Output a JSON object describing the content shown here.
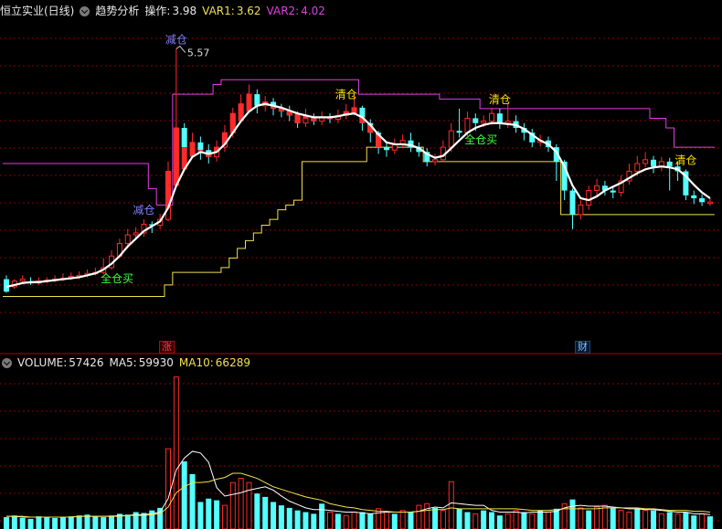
{
  "header": {
    "title": "恒立实业(日线)",
    "indicator_name": "趋势分析",
    "op_label": "操作:",
    "op_value": "3.98",
    "var1_label": "VAR1:",
    "var1_value": "3.62",
    "var2_label": "VAR2:",
    "var2_value": "4.02"
  },
  "volume_header": {
    "label": "VOLUME:",
    "value": "57426",
    "ma5_label": "MA5:",
    "ma5_value": "59930",
    "ma10_label": "MA10:",
    "ma10_value": "66289"
  },
  "markers": {
    "zhang": "涨",
    "cai": "财"
  },
  "colors": {
    "bg": "#000000",
    "up": "#ff2a2a",
    "down": "#54ffff",
    "ma": "#ffffff",
    "var1": "#f0e050",
    "var2": "#e040e0",
    "grid": "#8b0000",
    "label_yellow": "#ffe000",
    "label_green": "#40ff40",
    "label_blue": "#8080ff"
  },
  "chart_data": {
    "type": "candlestick",
    "peak_label": "5.57",
    "candles": [
      [
        3.18,
        3.05,
        3.22,
        3.04
      ],
      [
        3.1,
        3.16,
        3.18,
        3.08
      ],
      [
        3.16,
        3.18,
        3.22,
        3.14
      ],
      [
        3.15,
        3.14,
        3.2,
        3.12
      ],
      [
        3.14,
        3.16,
        3.2,
        3.12
      ],
      [
        3.16,
        3.17,
        3.2,
        3.14
      ],
      [
        3.17,
        3.18,
        3.22,
        3.15
      ],
      [
        3.18,
        3.19,
        3.24,
        3.16
      ],
      [
        3.19,
        3.21,
        3.25,
        3.17
      ],
      [
        3.21,
        3.22,
        3.26,
        3.18
      ],
      [
        3.22,
        3.24,
        3.28,
        3.2
      ],
      [
        3.24,
        3.25,
        3.3,
        3.22
      ],
      [
        3.25,
        3.3,
        3.4,
        3.23
      ],
      [
        3.3,
        3.42,
        3.48,
        3.28
      ],
      [
        3.42,
        3.55,
        3.6,
        3.4
      ],
      [
        3.55,
        3.64,
        3.7,
        3.5
      ],
      [
        3.64,
        3.66,
        3.72,
        3.6
      ],
      [
        3.66,
        3.75,
        3.8,
        3.62
      ],
      [
        3.75,
        3.74,
        3.78,
        3.66
      ],
      [
        3.74,
        3.8,
        3.86,
        3.7
      ],
      [
        3.8,
        4.3,
        4.4,
        3.78
      ],
      [
        4.3,
        4.75,
        5.57,
        4.2
      ],
      [
        4.75,
        4.55,
        4.8,
        4.4
      ],
      [
        4.55,
        4.6,
        4.7,
        4.45
      ],
      [
        4.6,
        4.52,
        4.66,
        4.42
      ],
      [
        4.52,
        4.45,
        4.58,
        4.38
      ],
      [
        4.45,
        4.55,
        4.62,
        4.4
      ],
      [
        4.55,
        4.7,
        4.78,
        4.5
      ],
      [
        4.7,
        4.9,
        4.96,
        4.65
      ],
      [
        4.9,
        5.0,
        5.1,
        4.85
      ],
      [
        5.0,
        5.1,
        5.2,
        4.92
      ],
      [
        5.1,
        4.98,
        5.15,
        4.9
      ],
      [
        4.98,
        5.02,
        5.08,
        4.92
      ],
      [
        5.02,
        4.95,
        5.06,
        4.88
      ],
      [
        4.95,
        4.92,
        5.0,
        4.86
      ],
      [
        4.92,
        4.88,
        4.98,
        4.82
      ],
      [
        4.88,
        4.8,
        4.92,
        4.75
      ],
      [
        4.8,
        4.85,
        4.95,
        4.76
      ],
      [
        4.85,
        4.82,
        4.9,
        4.78
      ],
      [
        4.82,
        4.86,
        4.92,
        4.78
      ],
      [
        4.86,
        4.84,
        4.9,
        4.8
      ],
      [
        4.84,
        4.88,
        4.94,
        4.8
      ],
      [
        4.88,
        4.92,
        5.0,
        4.84
      ],
      [
        4.92,
        4.96,
        5.1,
        4.88
      ],
      [
        4.96,
        4.8,
        4.98,
        4.72
      ],
      [
        4.8,
        4.7,
        4.84,
        4.6
      ],
      [
        4.7,
        4.55,
        4.72,
        4.48
      ],
      [
        4.55,
        4.52,
        4.6,
        4.45
      ],
      [
        4.52,
        4.58,
        4.64,
        4.48
      ],
      [
        4.58,
        4.62,
        4.68,
        4.54
      ],
      [
        4.62,
        4.55,
        4.7,
        4.5
      ],
      [
        4.55,
        4.5,
        4.6,
        4.45
      ],
      [
        4.5,
        4.4,
        4.54,
        4.35
      ],
      [
        4.4,
        4.42,
        4.48,
        4.36
      ],
      [
        4.42,
        4.55,
        4.62,
        4.4
      ],
      [
        4.55,
        4.72,
        4.8,
        4.5
      ],
      [
        4.72,
        4.7,
        4.95,
        4.65
      ],
      [
        4.7,
        4.85,
        4.92,
        4.66
      ],
      [
        4.85,
        4.8,
        4.9,
        4.72
      ],
      [
        4.8,
        4.82,
        4.88,
        4.76
      ],
      [
        4.82,
        4.9,
        4.96,
        4.78
      ],
      [
        4.9,
        4.8,
        4.95,
        4.74
      ],
      [
        4.8,
        4.82,
        5.0,
        4.75
      ],
      [
        4.82,
        4.75,
        4.88,
        4.7
      ],
      [
        4.75,
        4.7,
        4.8,
        4.62
      ],
      [
        4.7,
        4.6,
        4.74,
        4.55
      ],
      [
        4.6,
        4.62,
        4.68,
        4.56
      ],
      [
        4.62,
        4.55,
        4.66,
        4.5
      ],
      [
        4.55,
        4.4,
        4.58,
        4.2
      ],
      [
        4.4,
        4.1,
        4.42,
        4.0
      ],
      [
        4.1,
        3.85,
        4.12,
        3.7
      ],
      [
        3.85,
        3.95,
        4.0,
        3.8
      ],
      [
        3.95,
        4.1,
        4.15,
        3.9
      ],
      [
        4.1,
        4.15,
        4.22,
        4.05
      ],
      [
        4.15,
        4.1,
        4.2,
        4.05
      ],
      [
        4.1,
        4.08,
        4.15,
        4.02
      ],
      [
        4.08,
        4.2,
        4.26,
        4.04
      ],
      [
        4.2,
        4.3,
        4.38,
        4.16
      ],
      [
        4.3,
        4.38,
        4.46,
        4.25
      ],
      [
        4.38,
        4.42,
        4.5,
        4.34
      ],
      [
        4.42,
        4.35,
        4.46,
        4.28
      ],
      [
        4.35,
        4.4,
        4.45,
        4.3
      ],
      [
        4.4,
        4.35,
        4.44,
        4.1
      ],
      [
        4.35,
        4.3,
        4.4,
        4.2
      ],
      [
        4.3,
        4.05,
        4.32,
        4.0
      ],
      [
        4.05,
        4.02,
        4.1,
        3.96
      ],
      [
        4.02,
        3.98,
        4.06,
        3.94
      ],
      [
        3.98,
        3.98,
        4.02,
        3.94
      ]
    ],
    "ma": [
      3.1,
      3.12,
      3.14,
      3.15,
      3.15,
      3.16,
      3.17,
      3.18,
      3.19,
      3.2,
      3.22,
      3.24,
      3.28,
      3.34,
      3.42,
      3.52,
      3.6,
      3.68,
      3.73,
      3.78,
      3.92,
      4.15,
      4.32,
      4.45,
      4.5,
      4.48,
      4.5,
      4.58,
      4.7,
      4.82,
      4.92,
      4.98,
      5.0,
      4.98,
      4.96,
      4.93,
      4.9,
      4.88,
      4.86,
      4.86,
      4.86,
      4.87,
      4.89,
      4.9,
      4.86,
      4.78,
      4.68,
      4.6,
      4.58,
      4.58,
      4.57,
      4.54,
      4.48,
      4.44,
      4.46,
      4.54,
      4.62,
      4.7,
      4.75,
      4.78,
      4.8,
      4.8,
      4.79,
      4.78,
      4.74,
      4.68,
      4.62,
      4.58,
      4.5,
      4.35,
      4.15,
      4.02,
      4.0,
      4.04,
      4.1,
      4.14,
      4.18,
      4.23,
      4.28,
      4.32,
      4.34,
      4.35,
      4.34,
      4.32,
      4.25,
      4.16,
      4.08,
      4.02
    ],
    "var1": [
      3.0,
      3.0,
      3.0,
      3.0,
      3.0,
      3.0,
      3.0,
      3.0,
      3.0,
      3.0,
      3.0,
      3.0,
      3.0,
      3.0,
      3.0,
      3.0,
      3.0,
      3.0,
      3.0,
      3.0,
      3.12,
      3.25,
      3.25,
      3.25,
      3.25,
      3.25,
      3.25,
      3.3,
      3.4,
      3.5,
      3.58,
      3.66,
      3.74,
      3.8,
      3.9,
      3.95,
      4.0,
      4.4,
      4.4,
      4.4,
      4.4,
      4.4,
      4.4,
      4.4,
      4.4,
      4.55,
      4.55,
      4.55,
      4.55,
      4.55,
      4.55,
      4.55,
      4.4,
      4.4,
      4.4,
      4.4,
      4.4,
      4.4,
      4.4,
      4.4,
      4.4,
      4.4,
      4.4,
      4.4,
      4.4,
      4.4,
      4.4,
      4.4,
      4.4,
      3.85,
      3.85,
      3.85,
      3.85,
      3.85,
      3.85,
      3.85,
      3.85,
      3.85,
      3.85,
      3.85,
      3.85,
      3.85,
      3.85,
      3.85,
      3.85,
      3.85,
      3.85,
      3.85
    ],
    "var2": [
      4.38,
      4.38,
      4.38,
      4.38,
      4.38,
      4.38,
      4.38,
      4.38,
      4.38,
      4.38,
      4.38,
      4.38,
      4.38,
      4.38,
      4.38,
      4.38,
      4.38,
      4.38,
      4.12,
      3.95,
      3.95,
      5.1,
      5.1,
      5.1,
      5.1,
      5.1,
      5.2,
      5.25,
      5.25,
      5.25,
      5.25,
      5.25,
      5.25,
      5.25,
      5.25,
      5.25,
      5.25,
      5.25,
      5.25,
      5.25,
      5.25,
      5.25,
      5.25,
      5.25,
      5.1,
      5.1,
      5.1,
      5.1,
      5.1,
      5.1,
      5.1,
      5.1,
      5.1,
      5.1,
      5.05,
      5.05,
      5.05,
      5.05,
      5.05,
      4.95,
      4.95,
      4.95,
      4.95,
      4.95,
      4.95,
      4.95,
      4.95,
      4.95,
      4.95,
      4.95,
      4.95,
      4.95,
      4.95,
      4.95,
      4.95,
      4.95,
      4.95,
      4.95,
      4.95,
      4.95,
      4.85,
      4.85,
      4.75,
      4.55,
      4.55,
      4.55,
      4.55,
      4.55
    ],
    "signals": [
      {
        "i": 13,
        "text": "全仓买",
        "color": "green",
        "pos": "below"
      },
      {
        "i": 17,
        "text": "减仓",
        "color": "blue",
        "pos": "above"
      },
      {
        "i": 21,
        "text": "减仓",
        "color": "blue",
        "pos": "above"
      },
      {
        "i": 42,
        "text": "清仓",
        "color": "yellow",
        "pos": "above"
      },
      {
        "i": 58,
        "text": "全仓买",
        "color": "green",
        "pos": "below"
      },
      {
        "i": 61,
        "text": "清仓",
        "color": "yellow",
        "pos": "above"
      },
      {
        "i": 84,
        "text": "清仓",
        "color": "yellow",
        "pos": "above"
      }
    ],
    "volume": [
      [
        14,
        0
      ],
      [
        16,
        0
      ],
      [
        13,
        0
      ],
      [
        12,
        0
      ],
      [
        15,
        0
      ],
      [
        14,
        0
      ],
      [
        13,
        0
      ],
      [
        14,
        0
      ],
      [
        15,
        0
      ],
      [
        16,
        0
      ],
      [
        17,
        0
      ],
      [
        15,
        0
      ],
      [
        14,
        0
      ],
      [
        16,
        0
      ],
      [
        18,
        0
      ],
      [
        17,
        0
      ],
      [
        20,
        0
      ],
      [
        19,
        0
      ],
      [
        22,
        0
      ],
      [
        25,
        0
      ],
      [
        95,
        1
      ],
      [
        180,
        1
      ],
      [
        80,
        0
      ],
      [
        65,
        0
      ],
      [
        32,
        0
      ],
      [
        36,
        0
      ],
      [
        34,
        0
      ],
      [
        28,
        1
      ],
      [
        55,
        1
      ],
      [
        60,
        1
      ],
      [
        55,
        1
      ],
      [
        42,
        0
      ],
      [
        38,
        0
      ],
      [
        32,
        0
      ],
      [
        28,
        0
      ],
      [
        25,
        0
      ],
      [
        22,
        0
      ],
      [
        20,
        0
      ],
      [
        18,
        0
      ],
      [
        30,
        0
      ],
      [
        20,
        1
      ],
      [
        18,
        0
      ],
      [
        16,
        1
      ],
      [
        20,
        1
      ],
      [
        20,
        0
      ],
      [
        18,
        0
      ],
      [
        24,
        1
      ],
      [
        20,
        1
      ],
      [
        18,
        0
      ],
      [
        22,
        1
      ],
      [
        20,
        0
      ],
      [
        28,
        1
      ],
      [
        30,
        1
      ],
      [
        25,
        0
      ],
      [
        22,
        1
      ],
      [
        56,
        1
      ],
      [
        24,
        0
      ],
      [
        20,
        0
      ],
      [
        18,
        1
      ],
      [
        22,
        0
      ],
      [
        20,
        0
      ],
      [
        16,
        0
      ],
      [
        18,
        1
      ],
      [
        22,
        1
      ],
      [
        20,
        0
      ],
      [
        18,
        1
      ],
      [
        22,
        0
      ],
      [
        20,
        1
      ],
      [
        24,
        0
      ],
      [
        30,
        1
      ],
      [
        35,
        0
      ],
      [
        25,
        1
      ],
      [
        22,
        0
      ],
      [
        26,
        1
      ],
      [
        28,
        1
      ],
      [
        25,
        0
      ],
      [
        22,
        1
      ],
      [
        20,
        1
      ],
      [
        24,
        0
      ],
      [
        22,
        1
      ],
      [
        22,
        0
      ],
      [
        18,
        1
      ],
      [
        20,
        0
      ],
      [
        18,
        1
      ],
      [
        20,
        0
      ],
      [
        16,
        0
      ],
      [
        18,
        1
      ],
      [
        15,
        0
      ]
    ],
    "vol_ma5": [
      15,
      15,
      14,
      14,
      14,
      14,
      14,
      14,
      14,
      15,
      15,
      15,
      15,
      15,
      16,
      16,
      17,
      17,
      18,
      20,
      36,
      70,
      84,
      92,
      90,
      79,
      49,
      39,
      41,
      43,
      46,
      48,
      50,
      46,
      39,
      33,
      29,
      25,
      23,
      23,
      22,
      21,
      20,
      20,
      19,
      18,
      19,
      20,
      20,
      20,
      20,
      21,
      24,
      26,
      25,
      31,
      30,
      29,
      28,
      28,
      22,
      20,
      20,
      20,
      19,
      20,
      20,
      20,
      21,
      25,
      27,
      28,
      27,
      27,
      27,
      26,
      25,
      24,
      24,
      23,
      23,
      22,
      21,
      20,
      20,
      18,
      18,
      17
    ],
    "vol_ma10": [
      15,
      15,
      15,
      14,
      14,
      14,
      14,
      14,
      14,
      15,
      15,
      15,
      15,
      15,
      15,
      16,
      16,
      16,
      17,
      18,
      26,
      43,
      50,
      55,
      55,
      56,
      59,
      61,
      66,
      66,
      63,
      60,
      55,
      50,
      47,
      44,
      41,
      38,
      36,
      34,
      30,
      28,
      26,
      25,
      23,
      22,
      21,
      21,
      20,
      20,
      20,
      21,
      22,
      23,
      23,
      25,
      24,
      24,
      24,
      24,
      24,
      24,
      24,
      24,
      23,
      22,
      22,
      22,
      23,
      24,
      24,
      24,
      24,
      24,
      25,
      25,
      25,
      25,
      25,
      24,
      24,
      23,
      22,
      22,
      22,
      21,
      21,
      20
    ]
  }
}
